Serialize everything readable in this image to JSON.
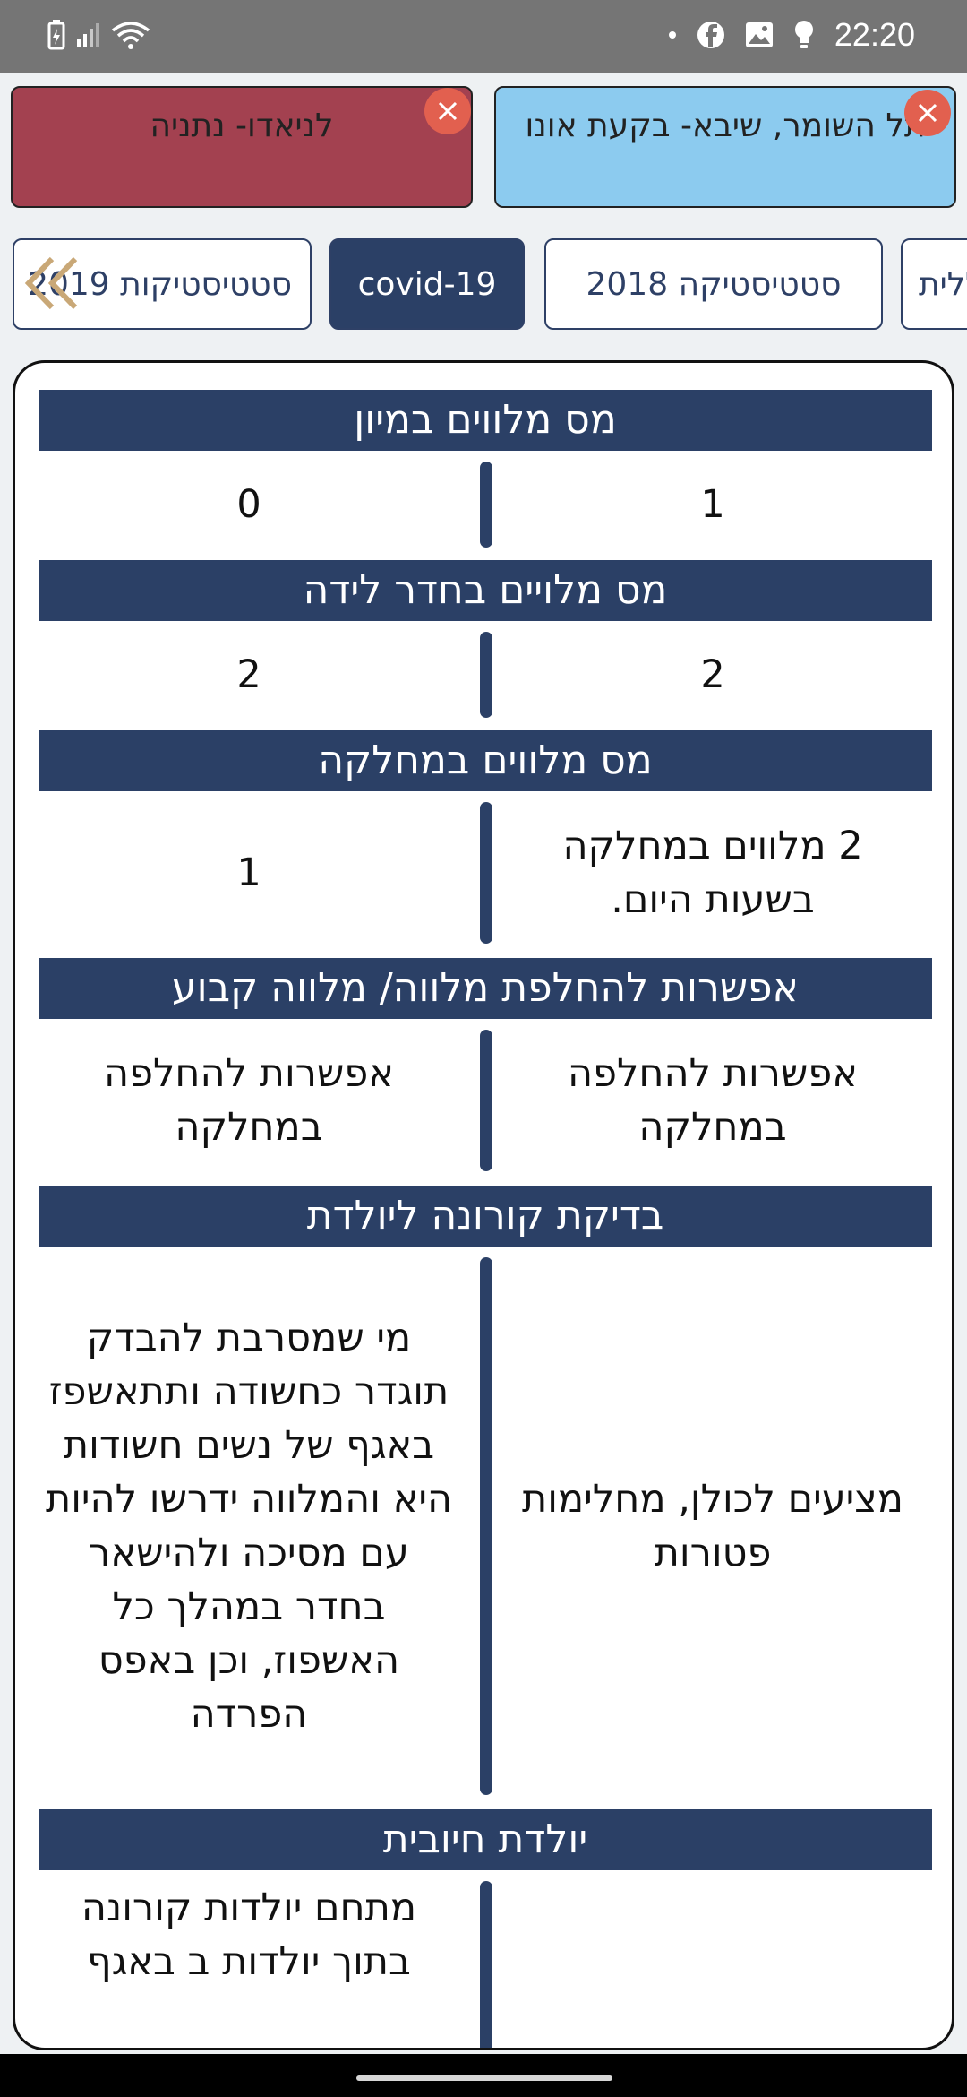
{
  "status_bar": {
    "time": "22:20",
    "left_icons": [
      "battery-charging-icon",
      "signal-icon",
      "wifi-icon"
    ],
    "right_icons": [
      "dot-icon",
      "facebook-icon",
      "gallery-icon",
      "bulb-icon"
    ]
  },
  "compare_cards": [
    {
      "label": "לניאדו- נתניה",
      "color": "#a34150"
    },
    {
      "label": "תל השומר, שיבא- בקעת אונו",
      "color": "#8ccbef"
    }
  ],
  "tabs": [
    {
      "label": "סטטיסטיקות 2019",
      "active": false
    },
    {
      "label": "covid-19",
      "active": true
    },
    {
      "label": "סטטיסטיקה 2018",
      "active": false
    },
    {
      "label": "כללית",
      "active": false
    }
  ],
  "sections": [
    {
      "title": "מס מלווים במיון",
      "right": "1",
      "left": "0"
    },
    {
      "title": "מס מלויים בחדר לידה",
      "right": "2",
      "left": "2"
    },
    {
      "title": "מס מלווים במחלקה",
      "right": "2 מלווים במחלקה בשעות היום.",
      "left": "1"
    },
    {
      "title": "אפשרות להחלפת מלווה/ מלווה קבוע",
      "right": "אפשרות להחלפה במחלקה",
      "left": "אפשרות להחלפה במחלקה"
    },
    {
      "title": "בדיקת קורונה ליולדת",
      "right": "מציעים לכולן, מחלימות פטורות",
      "left": "מי שמסרבת להבדק תוגדר כחשודה ותתאשפז באגף של נשים חשודות היא והמלווה ידרשו להיות עם מסיכה ולהישאר בחדר במהלך כל האשפוז, וכן באפס הפרדה"
    },
    {
      "title": "יולדת חיובית",
      "right": "",
      "left": "מתחם יולדות קורונה בתוך יולדות ב באגף"
    }
  ],
  "colors": {
    "primary": "#2b4066",
    "close": "#e2604f",
    "scroll_arrow": "#c9a877"
  }
}
